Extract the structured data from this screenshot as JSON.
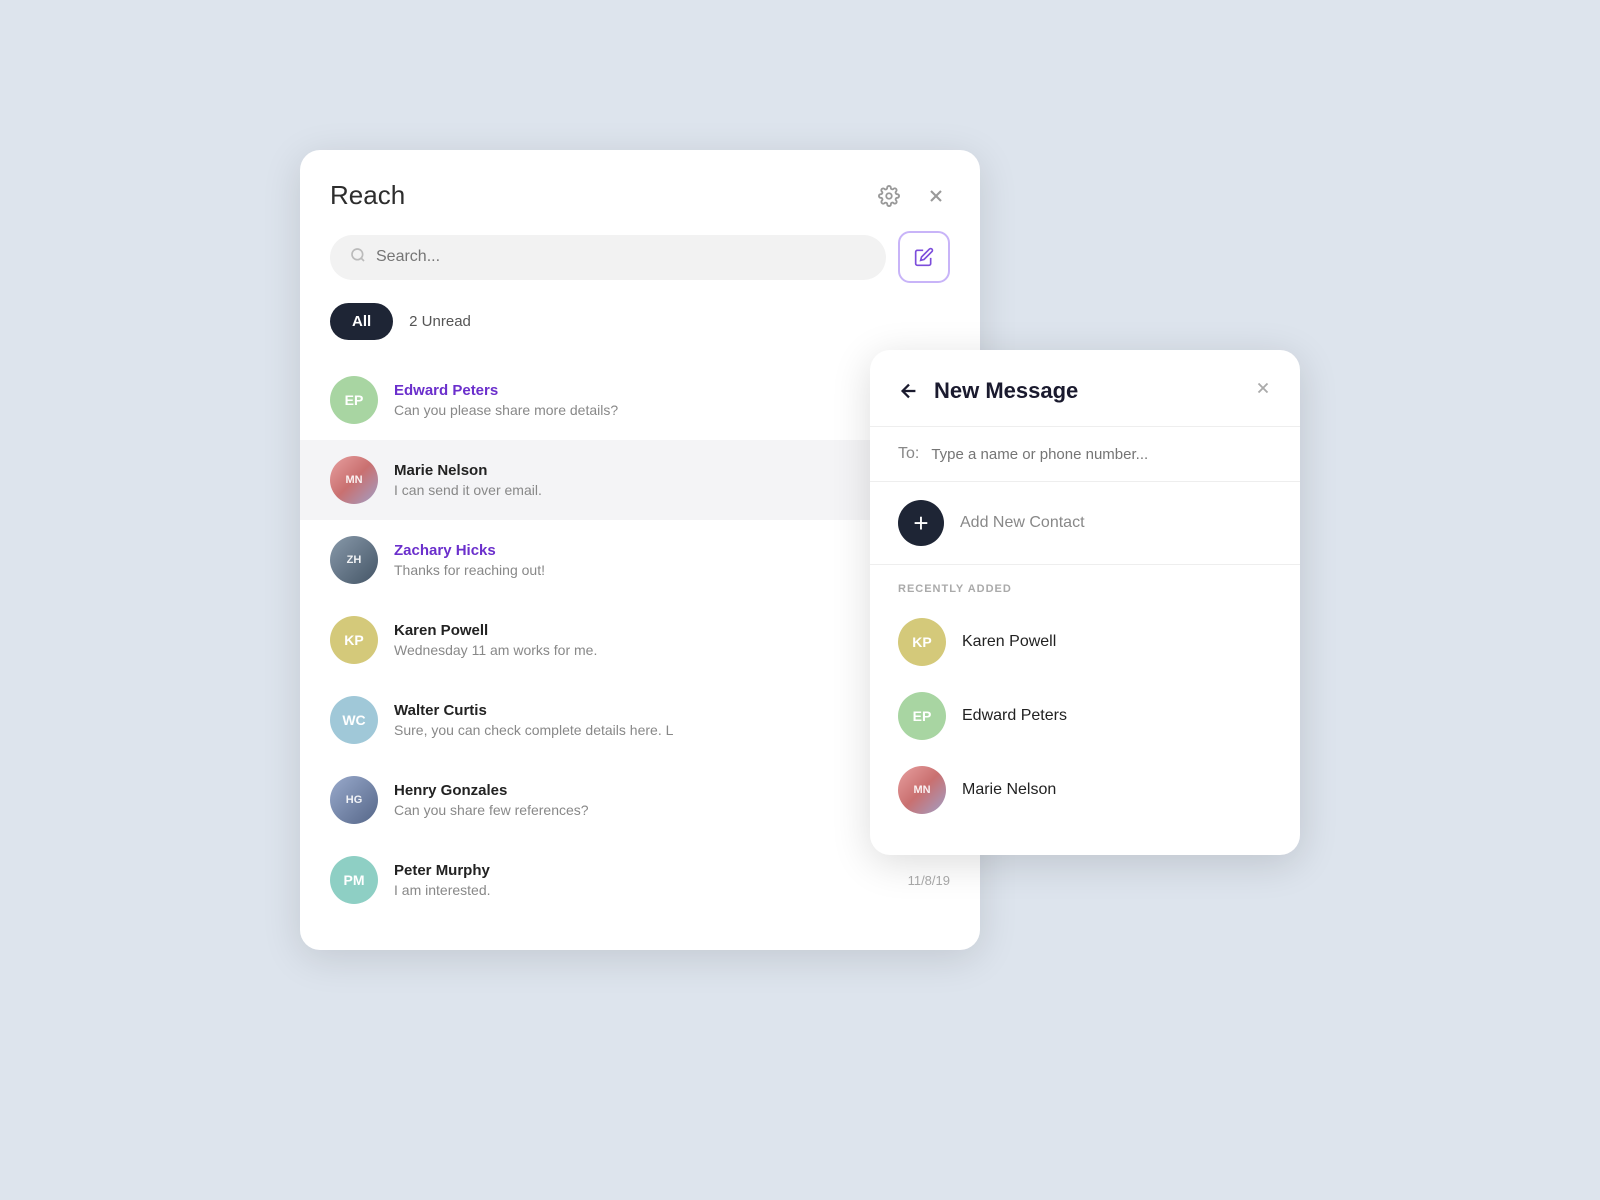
{
  "app": {
    "title": "Reach",
    "search_placeholder": "Search...",
    "gear_icon": "⚙",
    "close_icon": "✕",
    "compose_icon": "pencil"
  },
  "filter": {
    "all_label": "All",
    "unread_label": "2 Unread"
  },
  "conversations": [
    {
      "id": "1",
      "name": "Edward Peters",
      "initials": "EP",
      "avatar_class": "avatar-ep",
      "preview": "Can you please share more details?",
      "unread": true,
      "time": ""
    },
    {
      "id": "2",
      "name": "Marie Nelson",
      "initials": "MN",
      "avatar_class": "avatar-photo-marie",
      "preview": "I can send it over email.",
      "unread": false,
      "active": true,
      "time": ""
    },
    {
      "id": "3",
      "name": "Zachary Hicks",
      "initials": "ZH",
      "avatar_class": "avatar-photo-zachary",
      "preview": "Thanks for reaching out!",
      "unread": true,
      "time": ""
    },
    {
      "id": "4",
      "name": "Karen Powell",
      "initials": "KP",
      "avatar_class": "avatar-kp",
      "preview": "Wednesday 11 am works for me.",
      "unread": false,
      "time": ""
    },
    {
      "id": "5",
      "name": "Walter Curtis",
      "initials": "WC",
      "avatar_class": "avatar-wc",
      "preview": "Sure, you can check complete details here. L",
      "unread": false,
      "time": ""
    },
    {
      "id": "6",
      "name": "Henry Gonzales",
      "initials": "HG",
      "avatar_class": "avatar-photo-henry",
      "preview": "Can you share few references?",
      "unread": false,
      "time": ""
    },
    {
      "id": "7",
      "name": "Peter Murphy",
      "initials": "PM",
      "avatar_class": "avatar-pm",
      "preview": "I am interested.",
      "unread": false,
      "time": "11/8/19"
    }
  ],
  "new_message": {
    "title": "New Message",
    "back_icon": "←",
    "close_icon": "✕",
    "to_label": "To:",
    "to_placeholder": "Type a name or phone number...",
    "add_contact_label": "Add New Contact",
    "recently_added_title": "RECENTLY ADDED",
    "recently_added": [
      {
        "name": "Karen Powell",
        "initials": "KP",
        "avatar_class": "avatar-kp"
      },
      {
        "name": "Edward Peters",
        "initials": "EP",
        "avatar_class": "avatar-ep"
      },
      {
        "name": "Marie Nelson",
        "initials": "MN",
        "avatar_class": "avatar-photo-marie-sm"
      }
    ]
  }
}
